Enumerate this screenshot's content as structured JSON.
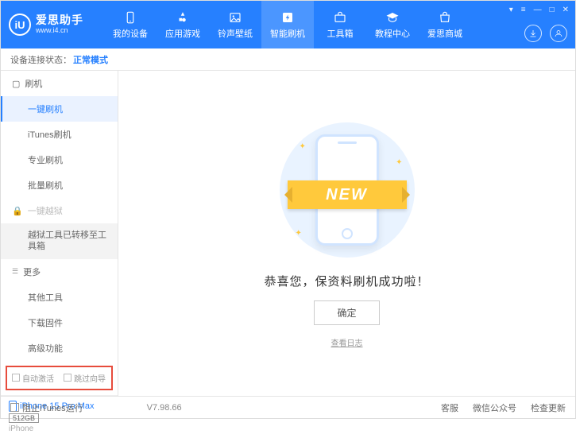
{
  "app": {
    "name": "爱思助手",
    "url": "www.i4.cn",
    "logo_letter": "iU"
  },
  "nav": [
    {
      "label": "我的设备"
    },
    {
      "label": "应用游戏"
    },
    {
      "label": "铃声壁纸"
    },
    {
      "label": "智能刷机"
    },
    {
      "label": "工具箱"
    },
    {
      "label": "教程中心"
    },
    {
      "label": "爱思商城"
    }
  ],
  "status": {
    "prefix": "设备连接状态：",
    "mode": "正常模式"
  },
  "sidebar": {
    "flash": {
      "header": "刷机",
      "items": [
        "一键刷机",
        "iTunes刷机",
        "专业刷机",
        "批量刷机"
      ]
    },
    "jailbreak": {
      "header": "一键越狱",
      "note": "越狱工具已转移至工具箱"
    },
    "more": {
      "header": "更多",
      "items": [
        "其他工具",
        "下载固件",
        "高级功能"
      ]
    },
    "checks": {
      "auto_activate": "自动激活",
      "skip_guide": "跳过向导"
    },
    "device": {
      "name": "iPhone 15 Pro Max",
      "storage": "512GB",
      "type": "iPhone"
    }
  },
  "main": {
    "ribbon": "NEW",
    "success": "恭喜您，保资料刷机成功啦！",
    "ok": "确定",
    "view_log": "查看日志"
  },
  "footer": {
    "block_itunes": "阻止iTunes运行",
    "version": "V7.98.66",
    "links": [
      "客服",
      "微信公众号",
      "检查更新"
    ]
  }
}
